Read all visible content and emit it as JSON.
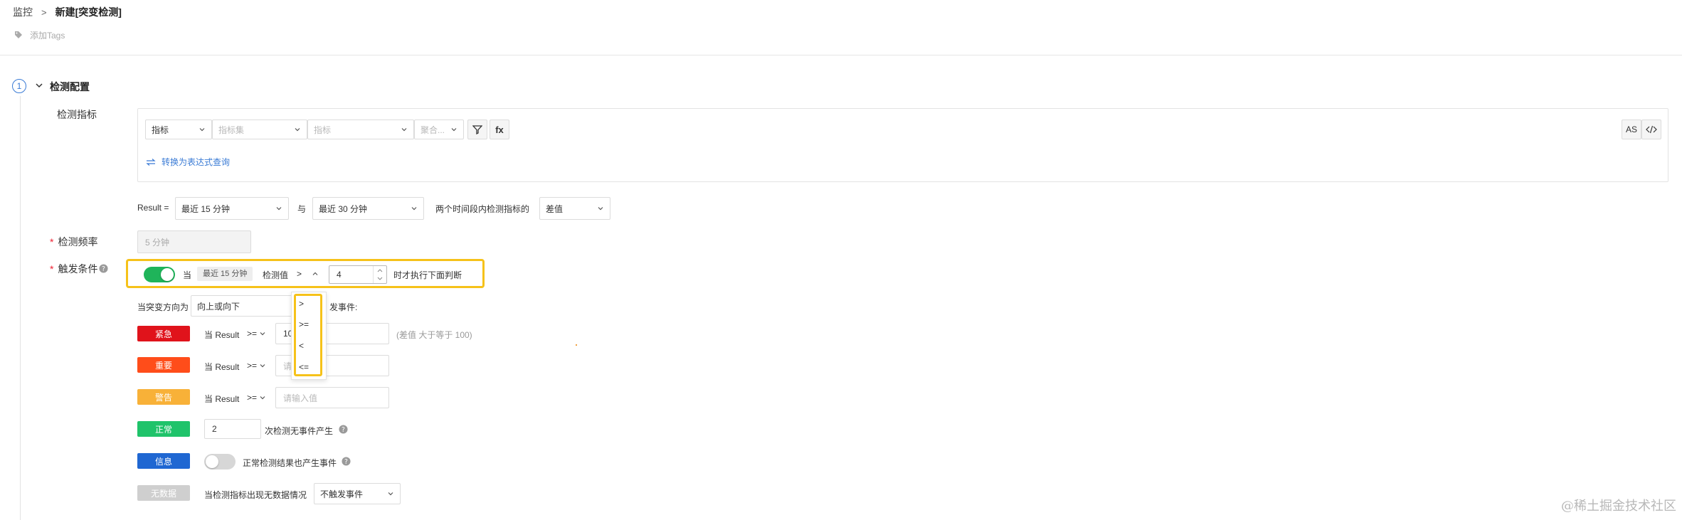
{
  "breadcrumb": {
    "parent": "监控",
    "current": "新建[突变检测]"
  },
  "tags": {
    "add_label": "添加Tags"
  },
  "section": {
    "step": "1",
    "title": "检测配置"
  },
  "metric": {
    "label": "检测指标",
    "type_select": "指标",
    "metric_set_placeholder": "指标集",
    "metric_placeholder": "指标",
    "aggregate_placeholder": "聚合...",
    "fx_label": "fx",
    "as_label": "AS",
    "switch_label": "转换为表达式查询"
  },
  "result_row": {
    "prefix": "Result =",
    "range_a": "最近 15 分钟",
    "and": "与",
    "range_b": "最近 30 分钟",
    "desc": "两个时间段内检测指标的",
    "func": "差值"
  },
  "frequency": {
    "label": "检测频率",
    "value": "5 分钟"
  },
  "trigger": {
    "label": "触发条件",
    "when": "当",
    "chip": "最近 15 分钟",
    "detect_value": "检测值",
    "operator": ">",
    "value": "4",
    "suffix": "时才执行下面判断",
    "options": [
      ">",
      ">=",
      "<",
      "<="
    ]
  },
  "direction": {
    "prefix": "当突变方向为",
    "value": "向上或向下",
    "suffix": "发事件:"
  },
  "levels": {
    "critical": {
      "badge": "紧急",
      "when": "当 Result",
      "op": ">=",
      "value": "10",
      "hint": "(差值 大于等于 100)"
    },
    "error": {
      "badge": "重要",
      "when": "当 Result",
      "op": ">=",
      "placeholder": "请输入值"
    },
    "warning": {
      "badge": "警告",
      "when": "当 Result",
      "op": ">=",
      "placeholder": "请输入值"
    },
    "ok": {
      "badge": "正常",
      "value": "2",
      "suffix": "次检测无事件产生"
    },
    "info": {
      "badge": "信息",
      "suffix": "正常检测结果也产生事件"
    },
    "nodata": {
      "badge": "无数据",
      "prefix": "当检测指标出现无数据情况",
      "value": "不触发事件"
    }
  },
  "watermark": "@稀土掘金技术社区",
  "colors": {
    "accent": "#3a7bd5",
    "highlight": "#f6c21a",
    "critical": "#e0131b",
    "error": "#ff4d1a",
    "warning": "#f8b138",
    "ok": "#1fc36a",
    "info": "#1f67d2",
    "nodata": "#cfcfcf"
  }
}
